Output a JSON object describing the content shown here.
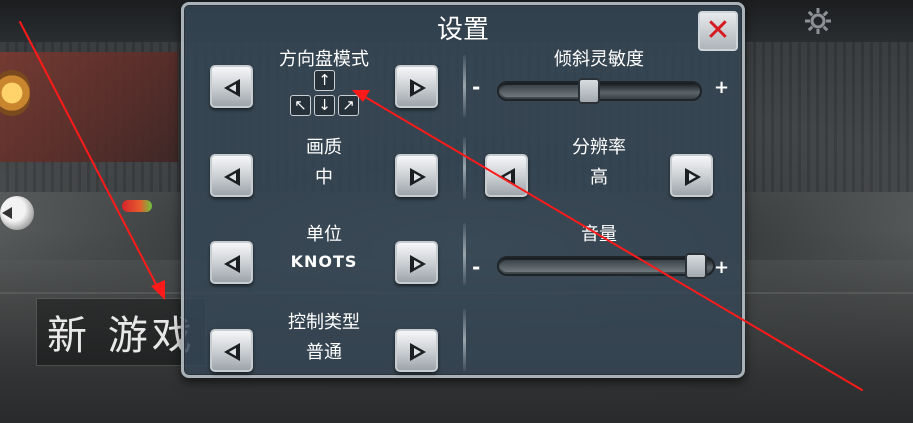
{
  "colors": {
    "panel_bg": "#344654",
    "panel_border": "#a9b2b8",
    "close_red": "#d61a22",
    "annotation_red": "#ff1a1a",
    "text": "#ffffff"
  },
  "background": {
    "new_game_label": "新 游戏",
    "settings_icon": "gear-icon",
    "left_toggle_icon": "chevron-left-icon"
  },
  "panel": {
    "title": "设置",
    "close_icon": "close-icon",
    "close_label": "✕",
    "left": {
      "steering": {
        "label": "方向盘模式",
        "keys": {
          "up": "↑",
          "left_up": "↖",
          "down": "↓",
          "right_up": "↗"
        }
      },
      "quality": {
        "label": "画质",
        "value": "中"
      },
      "units": {
        "label": "单位",
        "value": "KNOTS"
      },
      "control_type": {
        "label": "控制类型",
        "value": "普通"
      }
    },
    "right": {
      "tilt_sensitivity": {
        "label": "倾斜灵敏度",
        "minus": "-",
        "plus": "+",
        "level": 0.44
      },
      "resolution": {
        "label": "分辨率",
        "value": "高"
      },
      "volume": {
        "label": "音量",
        "minus": "-",
        "plus": "+",
        "level": 0.97
      }
    }
  }
}
